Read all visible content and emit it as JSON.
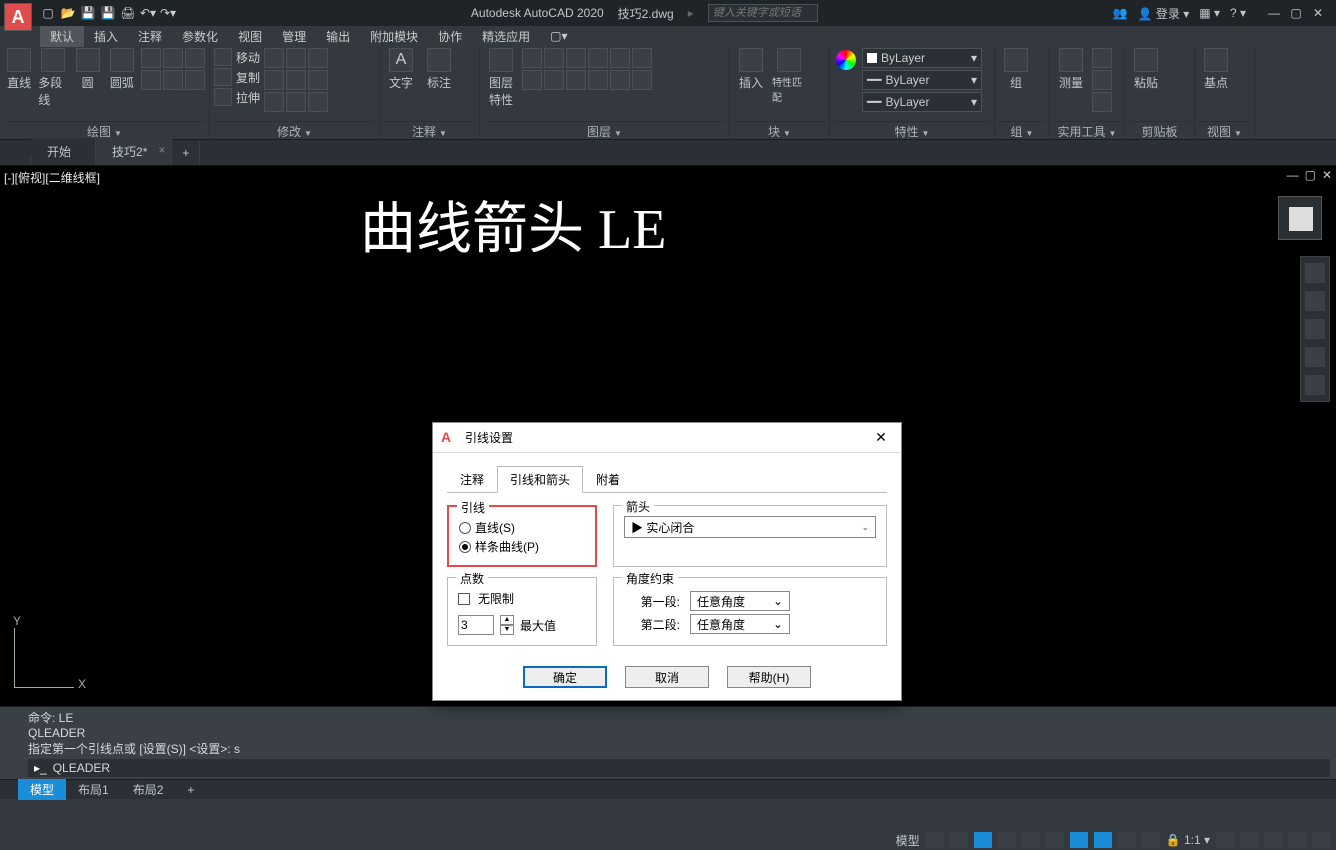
{
  "titlebar": {
    "app": "Autodesk AutoCAD 2020",
    "file": "技巧2.dwg",
    "search_placeholder": "键入关键字或短语",
    "login": "登录"
  },
  "menu": {
    "items": [
      "默认",
      "插入",
      "注释",
      "参数化",
      "视图",
      "管理",
      "输出",
      "附加模块",
      "协作",
      "精选应用"
    ],
    "active": 0
  },
  "ribbon": {
    "panels": [
      {
        "title": "绘图",
        "big": [
          "直线",
          "多段线",
          "圆",
          "圆弧"
        ]
      },
      {
        "title": "修改",
        "big": [],
        "labels": [
          "移动",
          "复制",
          "拉伸"
        ]
      },
      {
        "title": "注释",
        "big": [
          "文字",
          "标注"
        ]
      },
      {
        "title": "图层"
      },
      {
        "title": "块",
        "big": [
          "插入"
        ],
        "labels": [
          "特性匹配"
        ]
      },
      {
        "title": "特性",
        "layers": [
          "ByLayer",
          "ByLayer",
          "ByLayer"
        ]
      },
      {
        "title": "组",
        "big": [
          "组"
        ]
      },
      {
        "title": "实用工具",
        "big": [
          "测量"
        ]
      },
      {
        "title": "剪贴板",
        "big": [
          "粘贴"
        ]
      },
      {
        "title": "视图",
        "big": [
          "基点"
        ]
      }
    ]
  },
  "filetabs": {
    "tabs": [
      "开始",
      "技巧2*"
    ],
    "active": 1
  },
  "viewport": {
    "label": "[-][俯视][二维线框]",
    "bigtext": "曲线箭头   LE"
  },
  "cmd": {
    "l1": "命令:  LE",
    "l2": "QLEADER",
    "l3": "指定第一个引线点或 [设置(S)] <设置>: s",
    "input": "QLEADER"
  },
  "layouts": {
    "tabs": [
      "模型",
      "布局1",
      "布局2"
    ]
  },
  "status": {
    "left": "模型",
    "scale": "1:1"
  },
  "dialog": {
    "title": "引线设置",
    "tabs": [
      "注释",
      "引线和箭头",
      "附着"
    ],
    "active": 1,
    "grp_leader": "引线",
    "leader_straight": "直线(S)",
    "leader_spline": "样条曲线(P)",
    "grp_arrow": "箭头",
    "arrow_value": "实心闭合",
    "grp_points": "点数",
    "unlimited": "无限制",
    "max_value": "3",
    "max_label": "最大值",
    "grp_angle": "角度约束",
    "seg1": "第一段:",
    "seg2": "第二段:",
    "any_angle": "任意角度",
    "ok": "确定",
    "cancel": "取消",
    "help": "帮助(H)"
  }
}
